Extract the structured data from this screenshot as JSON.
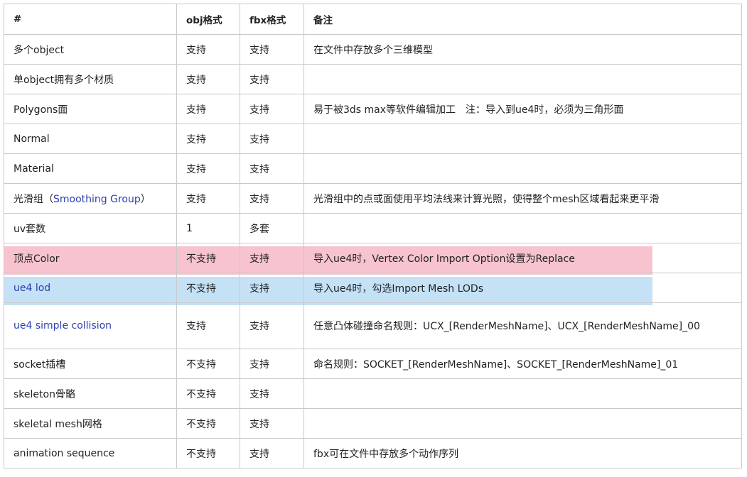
{
  "table": {
    "headers": [
      "#",
      "obj格式",
      "fbx格式",
      "备注"
    ],
    "rows": [
      {
        "feature": "多个object",
        "obj": "支持",
        "fbx": "支持",
        "note": "在文件中存放多个三维模型"
      },
      {
        "feature": "单object拥有多个材质",
        "obj": "支持",
        "fbx": "支持",
        "note": ""
      },
      {
        "feature": "Polygons面",
        "obj": "支持",
        "fbx": "支持",
        "note": "易于被3ds max等软件编辑加工　注：导入到ue4时，必须为三角形面"
      },
      {
        "feature": "Normal",
        "obj": "支持",
        "fbx": "支持",
        "note": ""
      },
      {
        "feature": "Material",
        "obj": "支持",
        "fbx": "支持",
        "note": ""
      },
      {
        "feature_prefix": "光滑组（",
        "feature_link": "Smoothing Group",
        "feature_suffix": "）",
        "obj": "支持",
        "fbx": "支持",
        "note": "光滑组中的点或面使用平均法线来计算光照，使得整个mesh区域看起来更平滑"
      },
      {
        "feature": "uv套数",
        "obj": "1",
        "fbx": "多套",
        "note": ""
      },
      {
        "feature": "顶点Color",
        "obj": "不支持",
        "fbx": "支持",
        "note": "导入ue4时，Vertex Color Import Option设置为Replace"
      },
      {
        "feature": "ue4 lod",
        "obj": "不支持",
        "fbx": "支持",
        "note": "导入ue4时，勾选Import Mesh LODs"
      },
      {
        "feature": "ue4 simple collision",
        "obj": "支持",
        "fbx": "支持",
        "note": "任意凸体碰撞命名规则：UCX_[RenderMeshName]、UCX_[RenderMeshName]_00"
      },
      {
        "feature": "socket插槽",
        "obj": "不支持",
        "fbx": "支持",
        "note": "命名规则：SOCKET_[RenderMeshName]、SOCKET_[RenderMeshName]_01"
      },
      {
        "feature": "skeleton骨骼",
        "obj": "不支持",
        "fbx": "支持",
        "note": ""
      },
      {
        "feature": "skeletal mesh网格",
        "obj": "不支持",
        "fbx": "支持",
        "note": ""
      },
      {
        "feature": "animation sequence",
        "obj": "不支持",
        "fbx": "支持",
        "note": "fbx可在文件中存放多个动作序列"
      }
    ]
  },
  "colors": {
    "highlight_pink": "#f7c3cf",
    "highlight_blue": "#c4e1f6",
    "link_blue": "#2b3fae",
    "border": "#c9c9c9"
  }
}
